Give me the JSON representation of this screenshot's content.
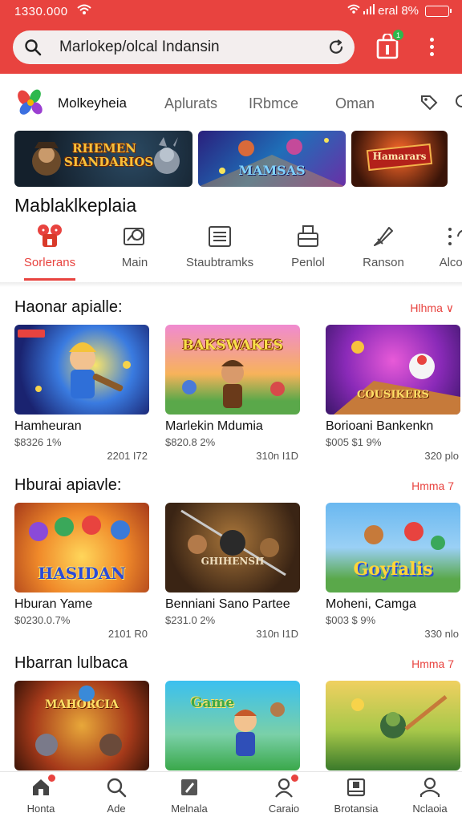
{
  "status": {
    "time": "1330.000",
    "signal": "eral 8%"
  },
  "search": {
    "text": "Marlokep/olcal Indansin"
  },
  "cart_badge": "1",
  "brand": {
    "name": "Molkeyheia"
  },
  "nav_tabs": [
    "Aplurats",
    "IRbmce",
    "Oman"
  ],
  "banners": [
    {
      "text": "RHEMEN SIANDARIOS"
    },
    {
      "text": "MAMSAS"
    },
    {
      "text": "Hamarars"
    }
  ],
  "section_title": "Mablaklkeplaia",
  "categories": [
    {
      "label": "Sorlerans",
      "icon": "dice-icon"
    },
    {
      "label": "Main",
      "icon": "image-icon"
    },
    {
      "label": "Staubtramks",
      "icon": "list-icon"
    },
    {
      "label": "Penlol",
      "icon": "box-icon"
    },
    {
      "label": "Ranson",
      "icon": "rocket-icon"
    },
    {
      "label": "Alcola",
      "icon": "share-icon"
    }
  ],
  "rows": [
    {
      "title": "Haonar apialle:",
      "more": "Hlhma ∨",
      "games": [
        {
          "name": "Hamheuran",
          "price": "$8326 1%",
          "size": "2201 I72",
          "thumb_text": ""
        },
        {
          "name": "Marlekin Mdumia",
          "price": "$820.8 2%",
          "size": "310n I1D",
          "thumb_text": "BAKSWAKES"
        },
        {
          "name": "Borioani Bankenkn",
          "price": "$005 $1 9%",
          "size": "320 plo",
          "thumb_text": "COUSIKERS"
        }
      ]
    },
    {
      "title": "Hburai apiavle:",
      "more": "Hmma 7",
      "games": [
        {
          "name": "Hburan Yame",
          "price": "$0230.0.7%",
          "size": "2101 R0",
          "thumb_text": "HASIDAN"
        },
        {
          "name": "Benniani Sano Partee",
          "price": "$231.0 2%",
          "size": "310n I1D",
          "thumb_text": "GHIHENSH"
        },
        {
          "name": "Moheni, Camga",
          "price": "$003 $ 9%",
          "size": "330 nlo",
          "thumb_text": "Goyfalis"
        }
      ]
    },
    {
      "title": "Hbarran lulbaca",
      "more": "Hmma 7",
      "games": [
        {
          "name": "",
          "price": "",
          "size": "",
          "thumb_text": "MAHORCIA"
        },
        {
          "name": "",
          "price": "",
          "size": "",
          "thumb_text": "Game"
        },
        {
          "name": "",
          "price": "",
          "size": "",
          "thumb_text": ""
        }
      ]
    }
  ],
  "bottom_nav": [
    {
      "label": "Honta",
      "icon": "home-icon",
      "badge": true
    },
    {
      "label": "Ade",
      "icon": "search-icon",
      "badge": false
    },
    {
      "label": "Melnala",
      "icon": "edit-icon",
      "badge": false
    },
    {
      "label": "Caraio",
      "icon": "user-icon",
      "badge": true
    },
    {
      "label": "Brotansia",
      "icon": "tablet-icon",
      "badge": false
    },
    {
      "label": "Nclaoia",
      "icon": "person-icon",
      "badge": false
    }
  ],
  "colors": {
    "accent": "#e8433f",
    "badge_green": "#2db84d"
  }
}
